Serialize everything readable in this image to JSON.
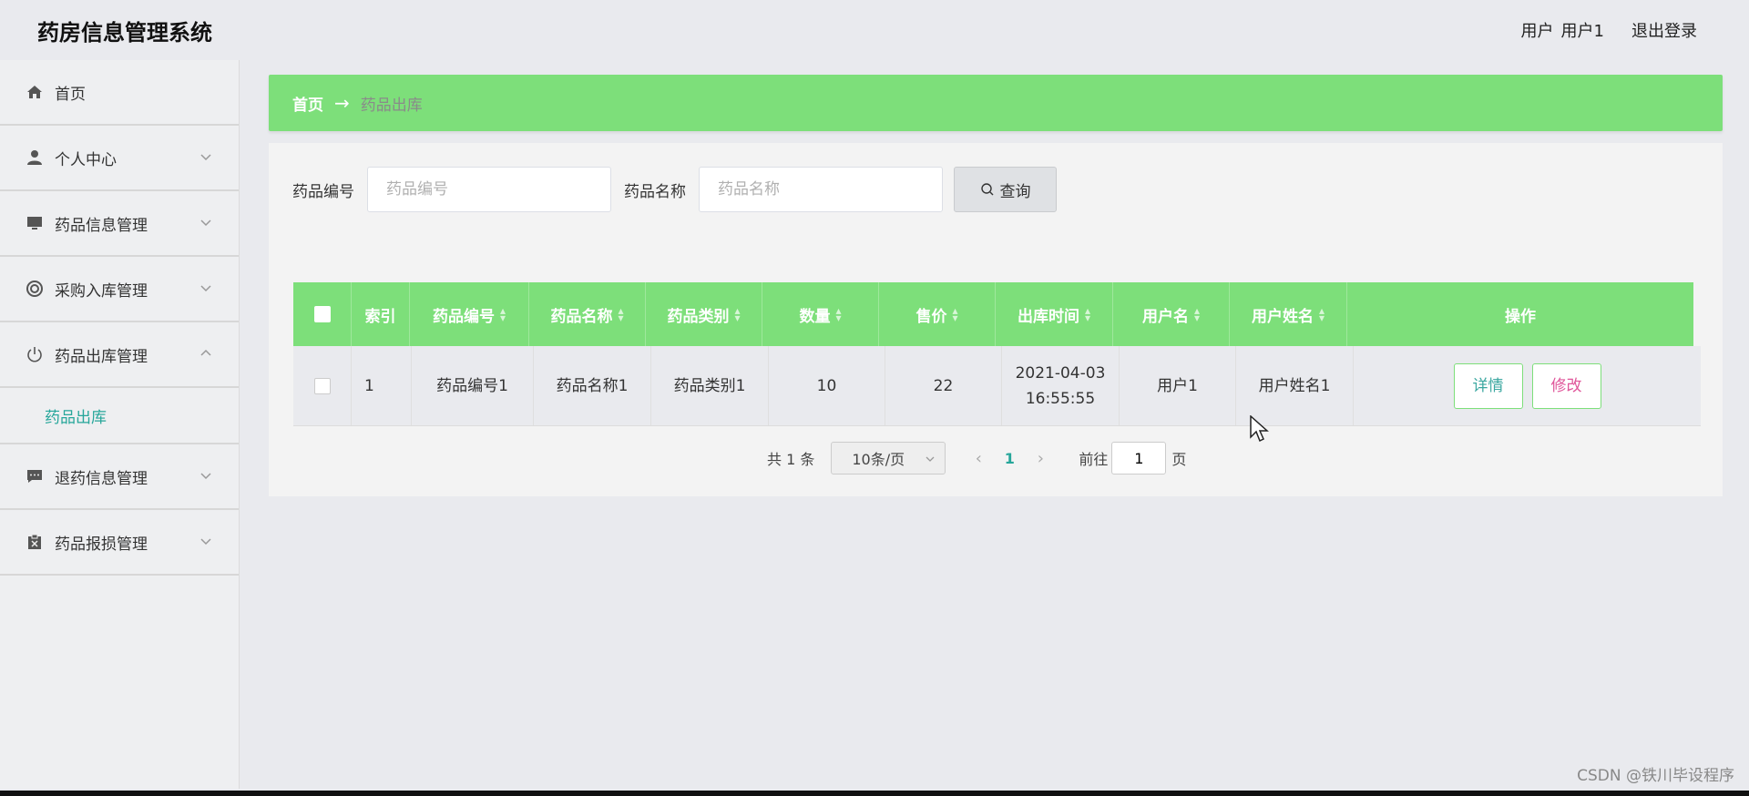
{
  "header": {
    "title": "药房信息管理系统",
    "user_label": "用户",
    "user_name": "用户1",
    "logout": "退出登录"
  },
  "sidebar": {
    "items": [
      {
        "label": "首页",
        "icon": "home-icon"
      },
      {
        "label": "个人中心",
        "icon": "person-icon"
      },
      {
        "label": "药品信息管理",
        "icon": "monitor-icon"
      },
      {
        "label": "采购入库管理",
        "icon": "lifebuoy-icon"
      },
      {
        "label": "药品出库管理",
        "icon": "power-icon"
      },
      {
        "label": "退药信息管理",
        "icon": "chat-icon"
      },
      {
        "label": "药品报损管理",
        "icon": "clipboard-x-icon"
      }
    ],
    "active_sub": "药品出库"
  },
  "breadcrumb": {
    "home": "首页",
    "arrow": "→",
    "current": "药品出库"
  },
  "search": {
    "code_label": "药品编号",
    "code_placeholder": "药品编号",
    "name_label": "药品名称",
    "name_placeholder": "药品名称",
    "button": "查询"
  },
  "table": {
    "columns": [
      "索引",
      "药品编号",
      "药品名称",
      "药品类别",
      "数量",
      "售价",
      "出库时间",
      "用户名",
      "用户姓名",
      "操作"
    ],
    "rows": [
      {
        "index": "1",
        "code": "药品编号1",
        "name": "药品名称1",
        "category": "药品类别1",
        "quantity": "10",
        "price": "22",
        "date": "2021-04-03",
        "time": "16:55:55",
        "username": "用户1",
        "fullname": "用户姓名1",
        "detail": "详情",
        "edit": "修改"
      }
    ]
  },
  "pagination": {
    "total": "共 1 条",
    "page_size": "10条/页",
    "current_page": "1",
    "goto_label": "前往",
    "goto_value": "1",
    "page_suffix": "页"
  },
  "watermark": "CSDN @铁川毕设程序",
  "colors": {
    "accent_green": "#7ddf7a",
    "teal": "#26a69a",
    "pink": "#e0559a"
  }
}
